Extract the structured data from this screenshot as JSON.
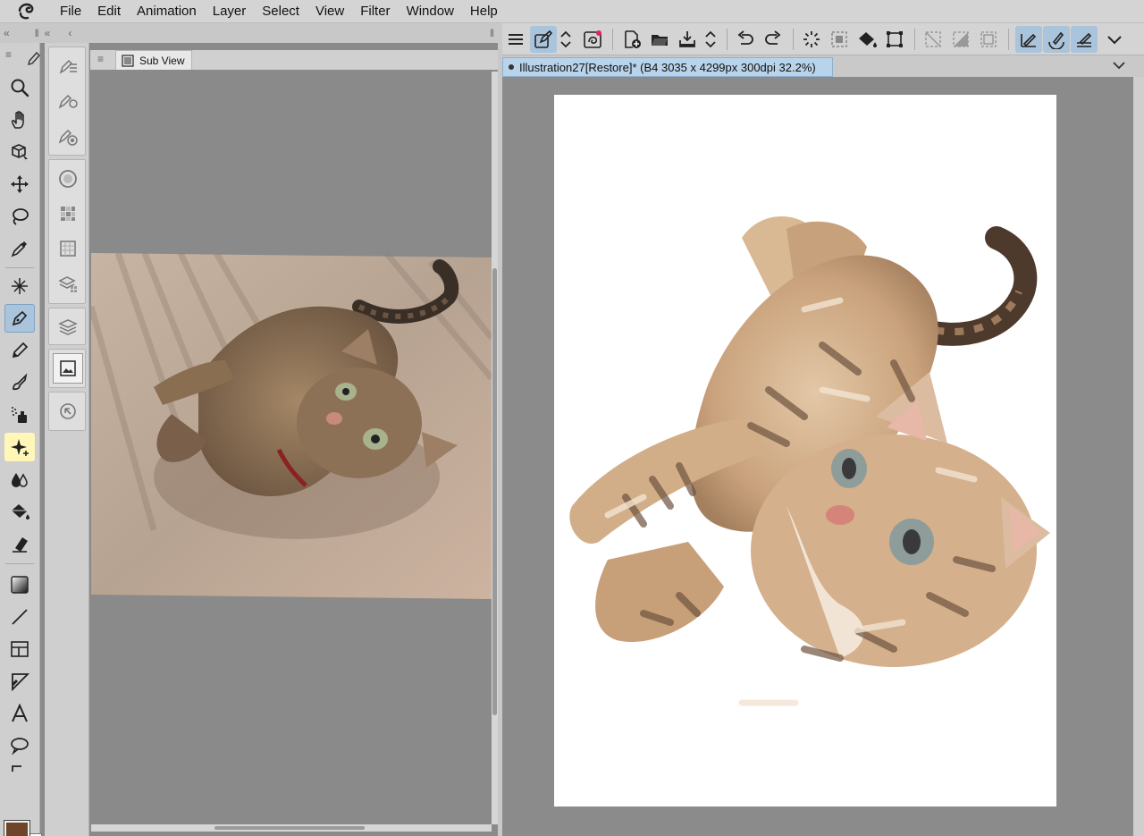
{
  "menu": {
    "items": [
      "File",
      "Edit",
      "Animation",
      "Layer",
      "Select",
      "View",
      "Filter",
      "Window",
      "Help"
    ]
  },
  "subview": {
    "tab_label": "Sub View"
  },
  "document": {
    "tab_label": "Illustration27[Restore]* (B4 3035 x 4299px 300dpi 32.2%)"
  },
  "colors": {
    "main_color": "#6e4528",
    "sub_color": "#ffffff",
    "accent": "#aac4dc"
  },
  "tools": [
    "zoom-icon",
    "hand-icon",
    "object-icon",
    "move-icon",
    "lasso-icon",
    "eyedropper-icon",
    "auto-select-icon",
    "pen-icon",
    "pencil-icon",
    "brush-icon",
    "airbrush-icon",
    "decoration-icon",
    "blend-icon",
    "fill-icon",
    "eraser-icon",
    "gradient-icon",
    "line-icon",
    "frame-icon",
    "ruler-icon",
    "text-icon",
    "balloon-icon"
  ]
}
